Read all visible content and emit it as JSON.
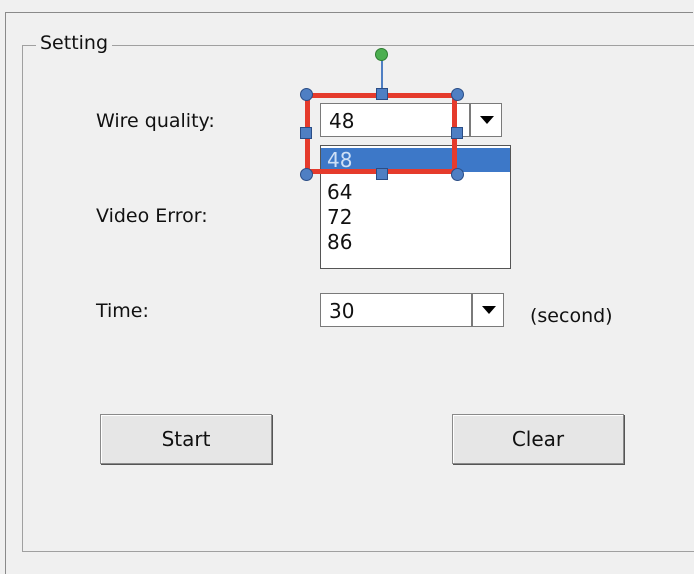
{
  "group": {
    "legend": "Setting"
  },
  "fields": {
    "wire_quality_label": "Wire quality:",
    "wire_quality_value": "48",
    "wire_quality_options": [
      "48",
      "64",
      "72",
      "86"
    ],
    "video_error_label": "Video Error:",
    "time_label": "Time:",
    "time_value": "30",
    "time_unit": "(second)"
  },
  "buttons": {
    "start": "Start",
    "clear": "Clear"
  },
  "colors": {
    "selection_outline": "#e53b2c",
    "handle": "#4f7fc3",
    "rotate_handle": "#4caf50",
    "selected_option": "#3d78c8"
  },
  "icons": {
    "dropdown": "chevron-down-icon"
  }
}
